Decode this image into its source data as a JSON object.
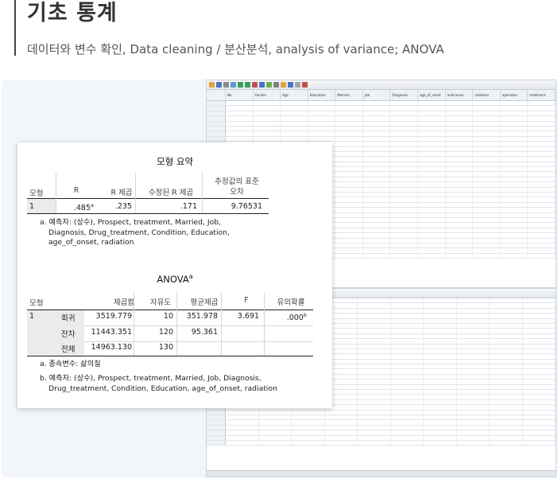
{
  "page": {
    "title": "기초 통계",
    "subtitle": "데이터와 변수 확인, Data cleaning / 분산분석, analysis of variance; ANOVA"
  },
  "model_summary": {
    "title": "모형 요약",
    "headers": {
      "model": "모형",
      "r": "R",
      "r2": "R 제곱",
      "adj_r2": "수정된 R 제곱",
      "se_line1": "추정값의 표준",
      "se_line2": "오차"
    },
    "row": {
      "model": "1",
      "r": ".485",
      "r_mark": "a",
      "r2": ".235",
      "adj_r2": ".171",
      "se": "9.76531"
    },
    "note_line1": "a. 예측자: (상수), Prospect, treatment, Married, Job,",
    "note_line2": "Diagnosis, Drug_treatment, Condition, Education,",
    "note_line3": "age_of_onset, radiation"
  },
  "anova": {
    "title": "ANOVA",
    "title_mark": "a",
    "headers": {
      "model": "모형",
      "ss": "제곱합",
      "df": "자유도",
      "ms": "평균제곱",
      "f": "F",
      "sig": "유의확률"
    },
    "model_no": "1",
    "rows": [
      {
        "label": "회귀",
        "ss": "3519.779",
        "df": "10",
        "ms": "351.978",
        "f": "3.691",
        "sig": ".000",
        "sig_mark": "b"
      },
      {
        "label": "잔차",
        "ss": "11443.351",
        "df": "120",
        "ms": "95.361",
        "f": "",
        "sig": "",
        "sig_mark": ""
      },
      {
        "label": "전체",
        "ss": "14963.130",
        "df": "130",
        "ms": "",
        "f": "",
        "sig": "",
        "sig_mark": ""
      }
    ],
    "note_a": "a. 종속변수: 삶의질",
    "note_b_line1": "b. 예측자: (상수), Prospect, treatment, Married, Job, Diagnosis,",
    "note_b_line2": "Drug_treatment, Condition, Education, age_of_onset, radiation"
  },
  "spreadsheet": {
    "columns": [
      "No",
      "Gender",
      "Age",
      "Education",
      "Married",
      "Job",
      "Diagnosis",
      "age_of_onset",
      "anticancer",
      "radiation",
      "operation",
      "treatment"
    ]
  }
}
